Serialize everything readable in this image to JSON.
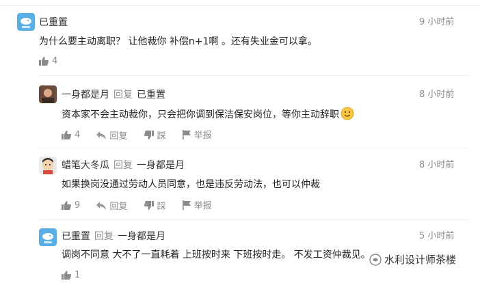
{
  "comments": [
    {
      "user": "已重置",
      "time": "9 小时前",
      "text": "为什么要主动离职？ 让他裁你 补偿n+1啊 。还有失业金可以拿。",
      "likes": "4",
      "avatar_icon": "default-avatar-icon"
    },
    {
      "user": "一身都是月",
      "reply_word": "回复",
      "reply_to": "已重置",
      "time": "8 小时前",
      "text": "资本家不会主动裁你，只会把你调到保洁保安岗位，等你主动辞职",
      "likes": "4",
      "reply_label": "回复",
      "dislike_label": "踩",
      "report_label": "举报",
      "avatar_icon": "user-photo-avatar"
    },
    {
      "user": "蜡笔大冬瓜",
      "reply_word": "回复",
      "reply_to": "一身都是月",
      "time": "8 小时前",
      "text": "如果换岗没通过劳动人员同意，也是违反劳动法，也可以仲裁",
      "likes": "9",
      "reply_label": "回复",
      "dislike_label": "踩",
      "report_label": "举报",
      "avatar_icon": "cartoon-avatar"
    },
    {
      "user": "已重置",
      "reply_word": "回复",
      "reply_to": "一身都是月",
      "time": "5 小时前",
      "text": "调岗不同意 大不了一直耗着 上班按时来 下班按时走。 不发工资仲裁见。",
      "likes": "1",
      "avatar_icon": "default-avatar-icon"
    }
  ],
  "watermark": "水利设计师茶楼",
  "colors": {
    "meta": "#8c8c8c",
    "text": "#222222",
    "avatar_blue": "#5aaee6"
  }
}
